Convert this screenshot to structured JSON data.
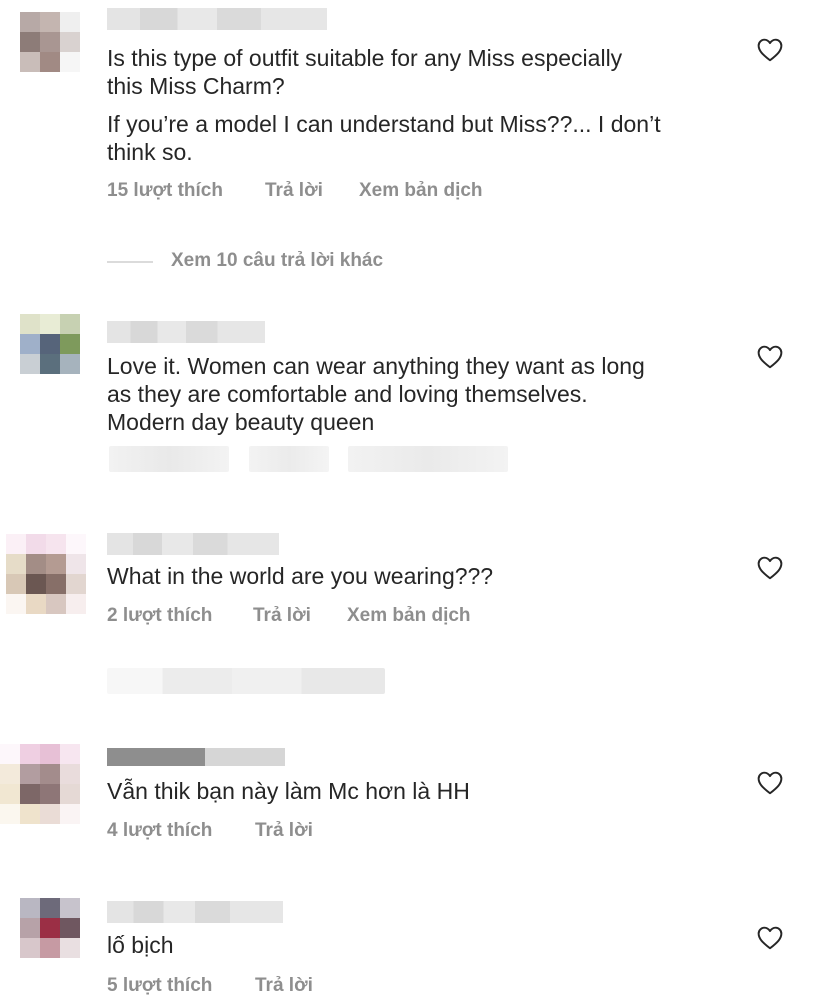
{
  "comments": [
    {
      "text_lines": [
        "Is this type of outfit suitable for any Miss especially",
        "this Miss Charm?"
      ],
      "text_lines2": [
        "If you’re a model I can understand but Miss??... I don’t",
        "think so."
      ],
      "likes": "15 lượt thích",
      "reply": "Trả lời",
      "translate": "Xem bản dịch",
      "view_replies": "Xem 10 câu trả lời khác"
    },
    {
      "text_lines": [
        "Love it. Women can wear anything they want as long",
        "as they are comfortable and loving themselves.",
        "Modern day beauty queen"
      ]
    },
    {
      "text": "What in the world are you wearing???",
      "likes": "2 lượt thích",
      "reply": "Trả lời",
      "translate": "Xem bản dịch"
    },
    {
      "text": "Vẫn thik bạn này làm Mc hơn là HH",
      "likes": "4 lượt thích",
      "reply": "Trả lời"
    },
    {
      "text": "lố bịch",
      "likes": "5 lượt thích",
      "reply": "Trả lời"
    }
  ],
  "colors": {
    "text": "#262626",
    "meta": "#8e8e8e",
    "divider": "#dbdbdb"
  },
  "icons": {
    "like": "heart-outline-icon"
  }
}
